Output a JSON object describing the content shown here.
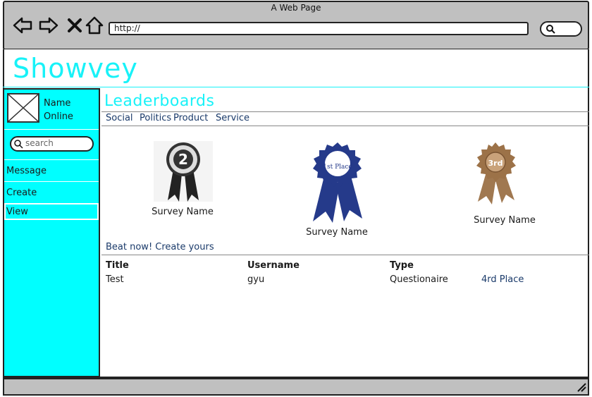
{
  "browser": {
    "window_title": "A Web Page",
    "address": "http://"
  },
  "app": {
    "title": "Showvey"
  },
  "sidebar": {
    "user_name": "Name",
    "user_status": "Online",
    "search_placeholder": "search",
    "items": [
      {
        "label": "Message"
      },
      {
        "label": "Create"
      },
      {
        "label": "View",
        "selected": true
      }
    ]
  },
  "main": {
    "section_title": "Leaderboards",
    "tabs": [
      "Social",
      "Politics",
      "Product",
      "Service"
    ],
    "medals": [
      {
        "rank_badge": "2",
        "survey_name": "Survey Name"
      },
      {
        "rank_badge": "1st Place",
        "survey_name": "Survey Name"
      },
      {
        "rank_badge": "3rd",
        "survey_name": "Survey Name"
      }
    ],
    "cta": "Beat now! Create yours",
    "table": {
      "headers": [
        "Title",
        "Username",
        "Type"
      ],
      "rows": [
        {
          "title": "Test",
          "username": "gyu",
          "type": "Questionaire",
          "place": "4rd Place"
        }
      ]
    }
  },
  "colors": {
    "accent": "#00ffff",
    "title": "#18f2f8",
    "link": "#1a3a6a",
    "chrome": "#c0c0c0"
  }
}
